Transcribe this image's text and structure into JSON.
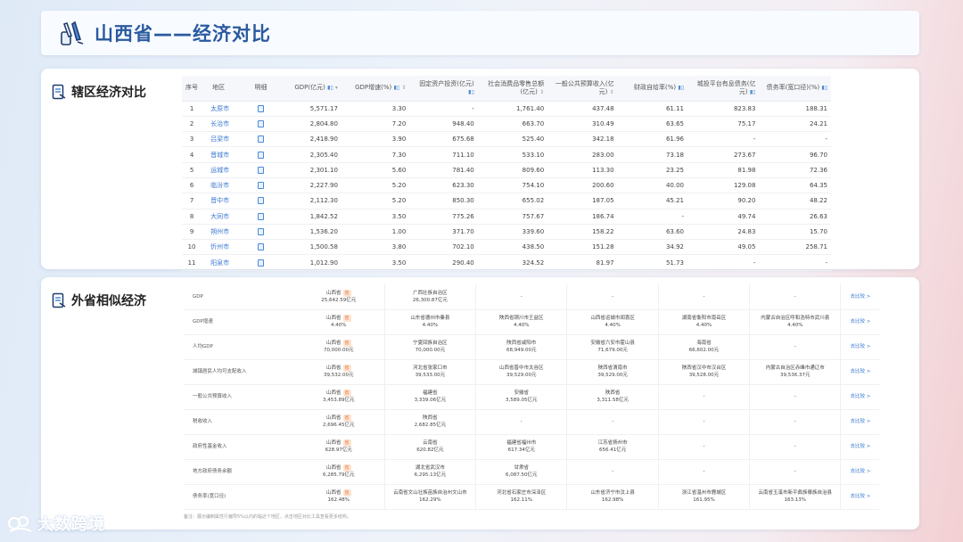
{
  "page_title": "山西省——经济对比",
  "section1": {
    "title": "辖区经济对比",
    "headers": [
      "序号",
      "地区",
      "明细",
      "GDP(亿元)",
      "GDP增速(%)",
      "固定资产投资(亿元)",
      "社会消费品零售总额(亿元)",
      "一般公共预算收入(亿元)",
      "财政自给率(%)",
      "城投平台有息债务(亿元)",
      "债务率(宽口径)(%)"
    ],
    "rows": [
      [
        "1",
        "太原市",
        "5,571.17",
        "3.30",
        "-",
        "1,761.40",
        "437.48",
        "61.11",
        "823.83",
        "188.31"
      ],
      [
        "2",
        "长治市",
        "2,804.80",
        "7.20",
        "948.40",
        "663.70",
        "310.49",
        "63.65",
        "75.17",
        "24.21"
      ],
      [
        "3",
        "吕梁市",
        "2,418.90",
        "3.90",
        "675.68",
        "525.40",
        "342.18",
        "61.96",
        "-",
        "-"
      ],
      [
        "4",
        "晋城市",
        "2,305.40",
        "7.30",
        "711.10",
        "533.10",
        "283.00",
        "73.18",
        "273.67",
        "96.70"
      ],
      [
        "5",
        "运城市",
        "2,301.10",
        "5.60",
        "781.40",
        "809.60",
        "113.30",
        "23.25",
        "81.98",
        "72.36"
      ],
      [
        "6",
        "临汾市",
        "2,227.90",
        "5.20",
        "623.30",
        "754.10",
        "200.60",
        "40.00",
        "129.08",
        "64.35"
      ],
      [
        "7",
        "晋中市",
        "2,112.30",
        "5.20",
        "850.30",
        "655.02",
        "187.05",
        "45.21",
        "90.20",
        "48.22"
      ],
      [
        "8",
        "大同市",
        "1,842.52",
        "3.50",
        "775.26",
        "757.67",
        "186.74",
        "-",
        "49.74",
        "26.63"
      ],
      [
        "9",
        "朔州市",
        "1,536.20",
        "1.00",
        "371.70",
        "339.60",
        "158.22",
        "63.60",
        "24.83",
        "15.70"
      ],
      [
        "10",
        "忻州市",
        "1,500.58",
        "3.80",
        "702.10",
        "438.50",
        "151.28",
        "34.92",
        "49.05",
        "258.71"
      ],
      [
        "11",
        "阳泉市",
        "1,012.90",
        "3.50",
        "290.40",
        "324.52",
        "81.97",
        "51.73",
        "-",
        "-"
      ]
    ]
  },
  "section2": {
    "title": "外省相似经济",
    "more_label": "去比较 >",
    "badge": "省",
    "rows": [
      {
        "label": "GDP",
        "cells": [
          [
            "山西省",
            "25,642.59亿元"
          ],
          [
            "广西壮族自治区",
            "26,300.87亿元"
          ],
          [
            "-"
          ],
          [
            "-"
          ],
          [
            "-"
          ],
          [
            "-"
          ]
        ]
      },
      {
        "label": "GDP增速",
        "cells": [
          [
            "山西省",
            "4.40%"
          ],
          [
            "山东省德州市秦县",
            "4.40%"
          ],
          [
            "陕西省铜川市王益区",
            "4.40%"
          ],
          [
            "山西省运城市闻喜区",
            "4.40%"
          ],
          [
            "湖南省衡阳市南岳区",
            "4.40%"
          ],
          [
            "内蒙古自治区呼和浩特市武川县",
            "4.40%"
          ]
        ]
      },
      {
        "label": "人均GDP",
        "cells": [
          [
            "山西省",
            "70,000.00元"
          ],
          [
            "宁夏回族自治区",
            "70,000.00元"
          ],
          [
            "陕西省咸阳市",
            "68,949.00元"
          ],
          [
            "安徽省六安市霍山县",
            "71,679.00元"
          ],
          [
            "海南省",
            "66,602.00元"
          ],
          [
            "-"
          ]
        ]
      },
      {
        "label": "城镇居民人均可支配收入",
        "cells": [
          [
            "山西省",
            "39,532.00元"
          ],
          [
            "河北省张家口市",
            "39,533.00元"
          ],
          [
            "山西省晋中市太谷区",
            "39,529.00元"
          ],
          [
            "陕西省渭南市",
            "39,529.00元"
          ],
          [
            "陕西省汉中市汉台区",
            "39,528.00元"
          ],
          [
            "内蒙古自治区赤峰市通辽市",
            "39,536.37元"
          ]
        ]
      },
      {
        "label": "一般公共预算收入",
        "cells": [
          [
            "山西省",
            "3,453.89亿元"
          ],
          [
            "福建省",
            "3,339.06亿元"
          ],
          [
            "安徽省",
            "3,589.05亿元"
          ],
          [
            "陕西省",
            "3,311.58亿元"
          ],
          [
            "-"
          ],
          [
            "-"
          ]
        ]
      },
      {
        "label": "税收收入",
        "cells": [
          [
            "山西省",
            "2,696.45亿元"
          ],
          [
            "陕西省",
            "2,682.85亿元"
          ],
          [
            "-"
          ],
          [
            "-"
          ],
          [
            "-"
          ],
          [
            "-"
          ]
        ]
      },
      {
        "label": "政府性基金收入",
        "cells": [
          [
            "山西省",
            "628.97亿元"
          ],
          [
            "云南省",
            "620.82亿元"
          ],
          [
            "福建省福州市",
            "617.34亿元"
          ],
          [
            "江苏省扬州市",
            "656.41亿元"
          ],
          [
            "-"
          ],
          [
            "-"
          ]
        ]
      },
      {
        "label": "地方政府债务余额",
        "cells": [
          [
            "山西省",
            "6,285.79亿元"
          ],
          [
            "湖北省武汉市",
            "6,295.13亿元"
          ],
          [
            "甘肃省",
            "6,087.50亿元"
          ],
          [
            "-"
          ],
          [
            "-"
          ],
          [
            "-"
          ]
        ]
      },
      {
        "label": "债务率(宽口径)",
        "cells": [
          [
            "山西省",
            "162.48%"
          ],
          [
            "云南省文山壮族苗族自治州文山市",
            "162.29%"
          ],
          [
            "河北省石家庄市深泽区",
            "162.11%"
          ],
          [
            "山东省济宁市汶上县",
            "162.98%"
          ],
          [
            "浙江省温州市鹿城区",
            "161.95%"
          ],
          [
            "云南省玉溪市新平彝族傣族自治县",
            "163.13%"
          ]
        ]
      }
    ],
    "note": "备注：展示编制属性行偏导5%以内的临近个地区，点击地区对比工具查看更多结构。"
  },
  "brand": "大数跨境"
}
